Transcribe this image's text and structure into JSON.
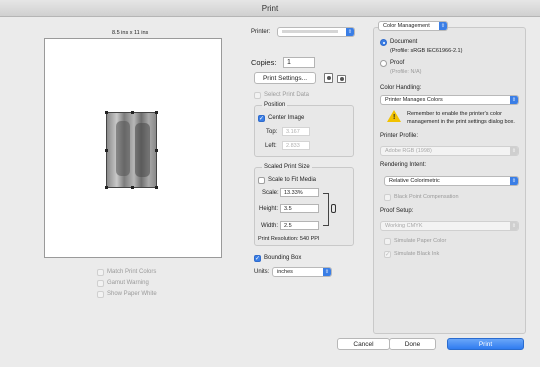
{
  "window": {
    "title": "Print"
  },
  "preview": {
    "page_size": "8.5 ins x 11 ins"
  },
  "left_options": {
    "match_print_colors": "Match Print Colors",
    "gamut_warning": "Gamut Warning",
    "show_paper_white": "Show Paper White"
  },
  "printer": {
    "label": "Printer:"
  },
  "copies": {
    "label": "Copies:",
    "value": "1"
  },
  "print_settings": {
    "label": "Print Settings..."
  },
  "layout_label": "Select Print Data",
  "position": {
    "title": "Position",
    "center_image": "Center Image",
    "top_label": "Top:",
    "top_value": "3.167",
    "left_label": "Left:",
    "left_value": "2.833"
  },
  "scaled": {
    "title": "Scaled Print Size",
    "scale_to_fit": "Scale to Fit Media",
    "scale_label": "Scale:",
    "scale_value": "13.33%",
    "height_label": "Height:",
    "height_value": "3.5",
    "width_label": "Width:",
    "width_value": "2.5",
    "resolution": "Print Resolution: 540 PPI"
  },
  "bounding_box": {
    "label": "Bounding Box"
  },
  "units": {
    "label": "Units:",
    "value": "inches"
  },
  "color_mgmt": {
    "section": "Color Management",
    "document_label": "Document",
    "document_profile": "(Profile: sRGB IEC61966-2.1)",
    "proof_label": "Proof",
    "proof_profile": "(Profile: N/A)",
    "color_handling_label": "Color Handling:",
    "color_handling_value": "Printer Manages Colors",
    "warning": "Remember to enable the printer's color management in the print settings dialog box.",
    "printer_profile_label": "Printer Profile:",
    "printer_profile_value": "Adobe RGB (1998)",
    "rendering_intent_label": "Rendering Intent:",
    "rendering_intent_value": "Relative Colorimetric",
    "black_point": "Black Point Compensation",
    "proof_setup_label": "Proof Setup:",
    "proof_setup_value": "Working CMYK",
    "simulate_paper": "Simulate Paper Color",
    "simulate_black": "Simulate Black Ink"
  },
  "buttons": {
    "cancel": "Cancel",
    "done": "Done",
    "print": "Print"
  },
  "colors": {
    "accent": "#3a7ee6",
    "window_bg": "#ebebeb"
  }
}
